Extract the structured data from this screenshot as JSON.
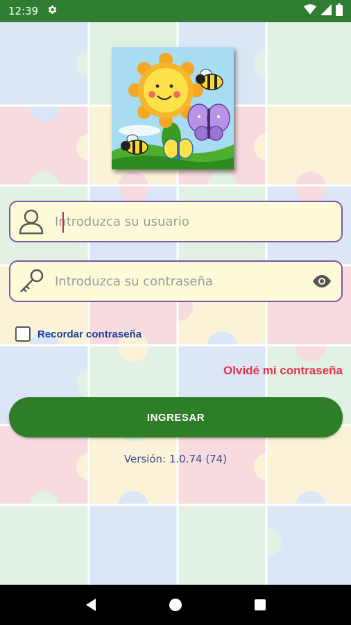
{
  "status_bar": {
    "time": "12:39",
    "icons": [
      "gear-icon",
      "wifi-icon",
      "signal-icon",
      "battery-icon"
    ]
  },
  "login": {
    "username_placeholder": "Introduzca su usuario",
    "password_placeholder": "Introduzca su contraseña",
    "remember_label": "Recordar contraseña",
    "remember_checked": false,
    "forgot_label": "Olvidé mi contraseña",
    "submit_label": "INGRESAR",
    "version_text": "Versión: 1.0.74 (74)"
  },
  "nav_bar": {
    "icons": [
      "back-icon",
      "home-icon",
      "recents-icon"
    ]
  },
  "colors": {
    "status_bar": "#2e7d32",
    "field_background": "#fdfbd8",
    "field_border": "#7e57a6",
    "primary_button": "#2e7d27",
    "forgot_link": "#e8334a",
    "remember_text": "#1a3fa0"
  }
}
